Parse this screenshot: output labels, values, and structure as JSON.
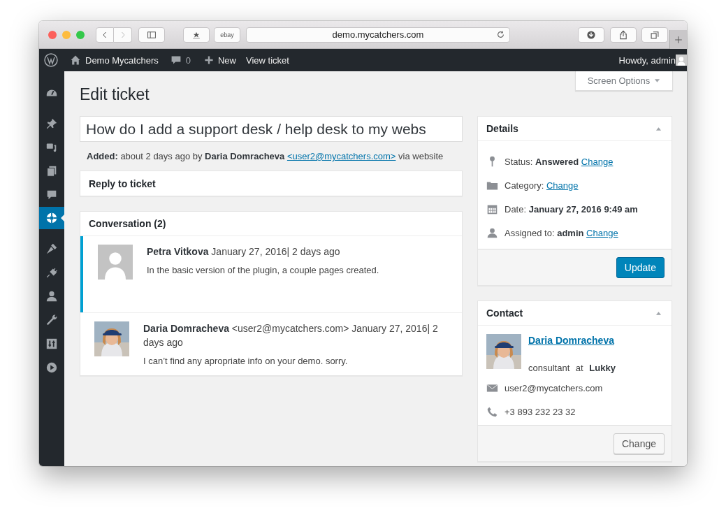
{
  "browser": {
    "url": "demo.mycatchers.com",
    "bookmarks": [
      "ebay"
    ]
  },
  "admin_bar": {
    "site": "Demo Mycatchers",
    "comments": "0",
    "new": "New",
    "view": "View ticket",
    "greeting": "Howdy, admin"
  },
  "sidebar": {
    "items": [
      {
        "kind": "dashboard",
        "selected": false
      },
      {
        "kind": "pin",
        "selected": false
      },
      {
        "kind": "media",
        "selected": false
      },
      {
        "kind": "pages",
        "selected": false
      },
      {
        "kind": "comments",
        "selected": false
      },
      {
        "kind": "lifebuoy",
        "selected": true
      },
      {
        "kind": "brush",
        "selected": false
      },
      {
        "kind": "plug",
        "selected": false
      },
      {
        "kind": "user",
        "selected": false
      },
      {
        "kind": "wrench",
        "selected": false
      },
      {
        "kind": "sliders",
        "selected": false
      },
      {
        "kind": "play",
        "selected": false
      }
    ]
  },
  "screen_options": "Screen Options",
  "page_title": "Edit ticket",
  "ticket": {
    "title": "How do I add a support desk / help desk to my webs",
    "meta_prefix": "**Added:** about 2 days ago by **Daria Domracheva**",
    "meta_email": "<user2@mycatchers.com>",
    "meta_suffix": "via website"
  },
  "reply_box": {
    "title": "Reply to ticket"
  },
  "conversation": {
    "title": "Conversation (2)",
    "messages": [
      {
        "heading": "**Petra Vitkova** January 27, 2016| 2 days ago",
        "text": "In the basic version of the plugin, a couple pages created.",
        "highlighted": true,
        "kind": "placeholder"
      },
      {
        "heading": "**Daria Domracheva** <user2@mycatchers.com> January 27, 2016| 2 days ago",
        "text": "I can’t find any apropriate info on your demo. sorry.",
        "highlighted": false,
        "kind": "picture"
      }
    ]
  },
  "details": {
    "title": "Details",
    "rows": [
      {
        "kind": "status",
        "text": "Status: **Answered**",
        "link": "Change"
      },
      {
        "kind": "category",
        "text": "Category:",
        "link": "Change"
      },
      {
        "kind": "date",
        "text": "Date: **January 27, 2016 9:49 am**"
      },
      {
        "kind": "assigned",
        "text": "Assigned to: **admin**",
        "link": "Change"
      }
    ],
    "button": "Update"
  },
  "contact": {
    "title": "Contact",
    "name": "Daria Domracheva",
    "role": "consultant at **Lukky**",
    "email": "user2@mycatchers.com",
    "phone": "+3 893 232 23 32",
    "button": "Change"
  }
}
